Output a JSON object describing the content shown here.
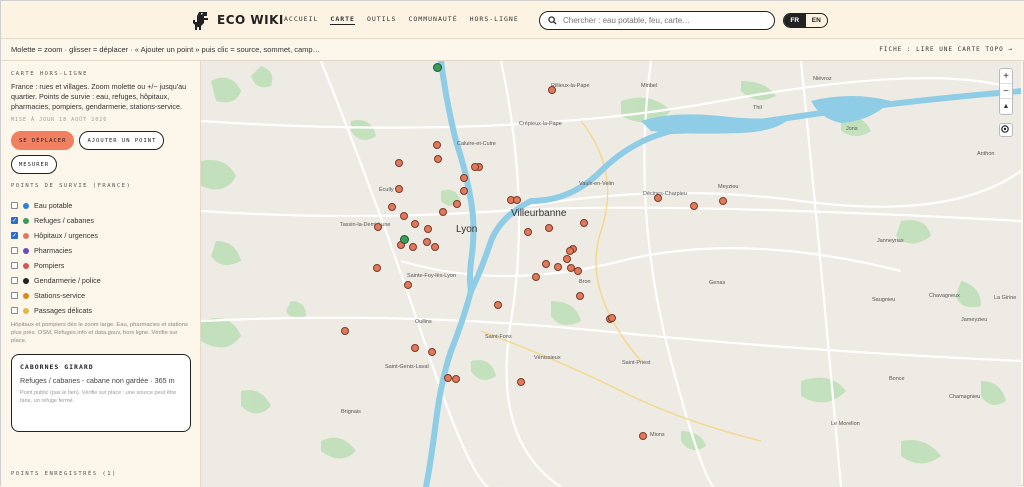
{
  "header": {
    "logo_text": "ECO WIKI",
    "nav": [
      "Accueil",
      "Carte",
      "Outils",
      "Communauté",
      "Hors-ligne"
    ],
    "active_nav": "Carte",
    "search_placeholder": "Chercher : eau potable, feu, carte…",
    "lang": [
      "FR",
      "EN"
    ]
  },
  "subbar": {
    "hint": "Molette = zoom · glisser = déplacer · « Ajouter un point » puis clic = source, sommet, camp…",
    "sheet_link": "Fiche : lire une carte topo →"
  },
  "sidebar": {
    "offline_title": "Carte hors-ligne",
    "offline_desc": "France : rues et villages. Zoom molette ou +/− jusqu'au quartier. Points de survie : eau, refuges, hôpitaux, pharmacies, pompiers, gendarmerie, stations-service.",
    "updated": "Mise à jour 18 août 2026",
    "buttons": {
      "move": "Se déplacer",
      "add": "Ajouter un point",
      "measure": "Mesurer"
    },
    "layers_title": "Points de survie (France)",
    "layers": [
      {
        "label": "Eau potable",
        "checked": false,
        "color": "#2e7fd6"
      },
      {
        "label": "Refuges / cabanes",
        "checked": true,
        "color": "#3c9a5a"
      },
      {
        "label": "Hôpitaux / urgences",
        "checked": true,
        "color": "#e1795a"
      },
      {
        "label": "Pharmacies",
        "checked": false,
        "color": "#6a4bc4"
      },
      {
        "label": "Pompiers",
        "checked": false,
        "color": "#d9534f"
      },
      {
        "label": "Gendarmerie / police",
        "checked": false,
        "color": "#222222"
      },
      {
        "label": "Stations-service",
        "checked": false,
        "color": "#d98a1e"
      },
      {
        "label": "Passages délicats",
        "checked": false,
        "color": "#e0b84a"
      }
    ],
    "layers_note": "Hôpitaux et pompiers dès le zoom large. Eau, pharmacies et stations plus près. OSM, Refuges.info et data.gouv, hors ligne. Vérifie sur place.",
    "card": {
      "title": "Cabornes Girard",
      "subtitle": "Refuges / cabanes - cabane non gardée · 365 m",
      "note": "Point public (pas le tien). Vérifie sur place : une source peut être tarie, un refuge fermé."
    },
    "saved_title": "Points enregistrés (1)"
  },
  "map": {
    "places": [
      {
        "name": "Rillieux-la-Pape",
        "big": false
      },
      {
        "name": "Miribel",
        "big": false
      },
      {
        "name": "Niévroz",
        "big": false
      },
      {
        "name": "Thil",
        "big": false
      },
      {
        "name": "Jons",
        "big": false
      },
      {
        "name": "Anthon",
        "big": false
      },
      {
        "name": "Crépieux-la-Pape",
        "big": false
      },
      {
        "name": "Caluire-et-Cuire",
        "big": false
      },
      {
        "name": "Vaulx-en-Velin",
        "big": false
      },
      {
        "name": "Décines-Charpieu",
        "big": false
      },
      {
        "name": "Meyzieu",
        "big": false
      },
      {
        "name": "Écully",
        "big": false
      },
      {
        "name": "Villeurbanne",
        "big": true
      },
      {
        "name": "Lyon",
        "big": true
      },
      {
        "name": "Tassin-la-Demi-Lune",
        "big": false
      },
      {
        "name": "Janneyrias",
        "big": false
      },
      {
        "name": "Sainte-Foy-lès-Lyon",
        "big": false
      },
      {
        "name": "Bron",
        "big": false
      },
      {
        "name": "Genas",
        "big": false
      },
      {
        "name": "Saugnieu",
        "big": false
      },
      {
        "name": "Chavagneux",
        "big": false
      },
      {
        "name": "Oullins",
        "big": false
      },
      {
        "name": "Saint-Fons",
        "big": false
      },
      {
        "name": "Jameyzieu",
        "big": false
      },
      {
        "name": "Vénissieux",
        "big": false
      },
      {
        "name": "Saint-Priest",
        "big": false
      },
      {
        "name": "Saint-Genis-Laval",
        "big": false
      },
      {
        "name": "Bonce",
        "big": false
      },
      {
        "name": "Brignais",
        "big": false
      },
      {
        "name": "Chamagnieu",
        "big": false
      },
      {
        "name": "Mions",
        "big": false
      },
      {
        "name": "Le Morellon",
        "big": false
      },
      {
        "name": "La Girine",
        "big": false
      }
    ],
    "zoom_in": "+",
    "zoom_out": "−",
    "north": "▲"
  }
}
